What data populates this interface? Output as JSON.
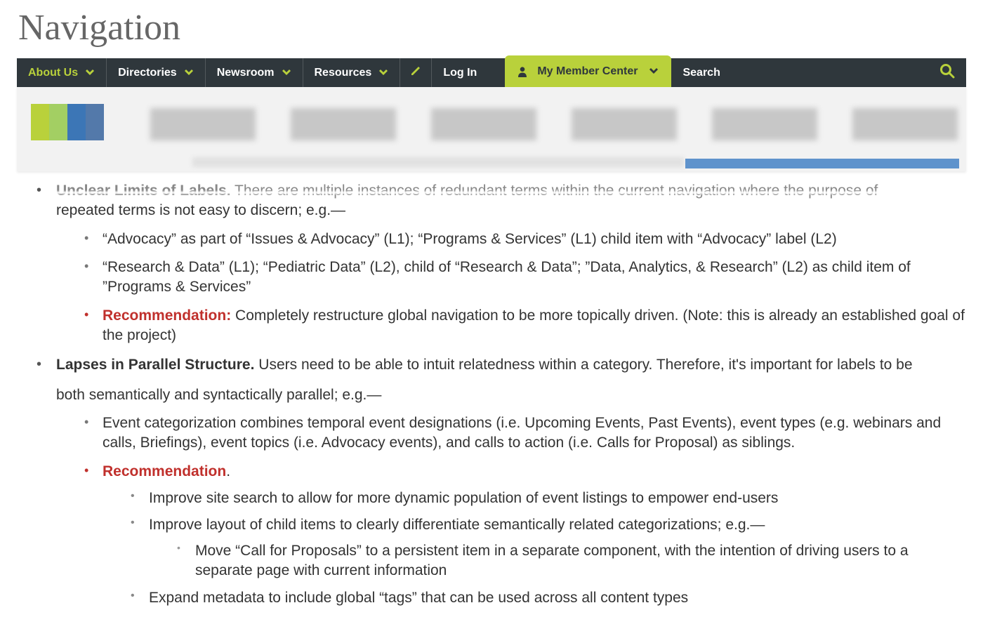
{
  "title": "Navigation",
  "nav": {
    "about": "About Us",
    "directories": "Directories",
    "newsroom": "Newsroom",
    "resources": "Resources",
    "login": "Log In",
    "member": "My Member Center",
    "search": "Search"
  },
  "sec1": {
    "lead_bold": "Unclear Limits of Labels.",
    "lead_rest": " There are multiple instances of redundant terms within the current navigation where the purpose of",
    "cont": "repeated terms is not easy to discern; e.g.—",
    "b1": "“Advocacy” as part of “Issues & Advocacy” (L1); “Programs & Services” (L1) child item with “Advocacy” label (L2)",
    "b2": "“Research & Data” (L1); “Pediatric Data” (L2), child of “Research & Data”; ”Data, Analytics, & Research” (L2) as child item of ”Programs & Services”",
    "rec_label": "Recommendation:",
    "rec_text": " Completely restructure global navigation to be more topically driven. (Note: this is already an established goal of the project)"
  },
  "sec2": {
    "lead_bold": "Lapses in Parallel Structure.",
    "lead_rest": " Users need to be able to intuit relatedness within a category. Therefore, it's important for labels to be",
    "cont": "both semantically and syntactically parallel; e.g.—",
    "b1": "Event categorization combines temporal event designations (i.e. Upcoming Events, Past Events), event types (e.g. webinars and calls, Briefings), event topics (i.e. Advocacy events), and calls to action (i.e. Calls for Proposal) as siblings.",
    "rec_label": "Recommendation",
    "rec_dot": ".",
    "r1": "Improve site search to allow for more dynamic population of event listings to empower end-users",
    "r2": "Improve layout of child items to clearly differentiate semantically related categorizations; e.g.—",
    "r2a": "Move “Call for Proposals” to a persistent item in a separate component, with the intention of driving users to a separate page with current information",
    "r3": "Expand metadata to include global “tags” that can be used across all content types"
  }
}
